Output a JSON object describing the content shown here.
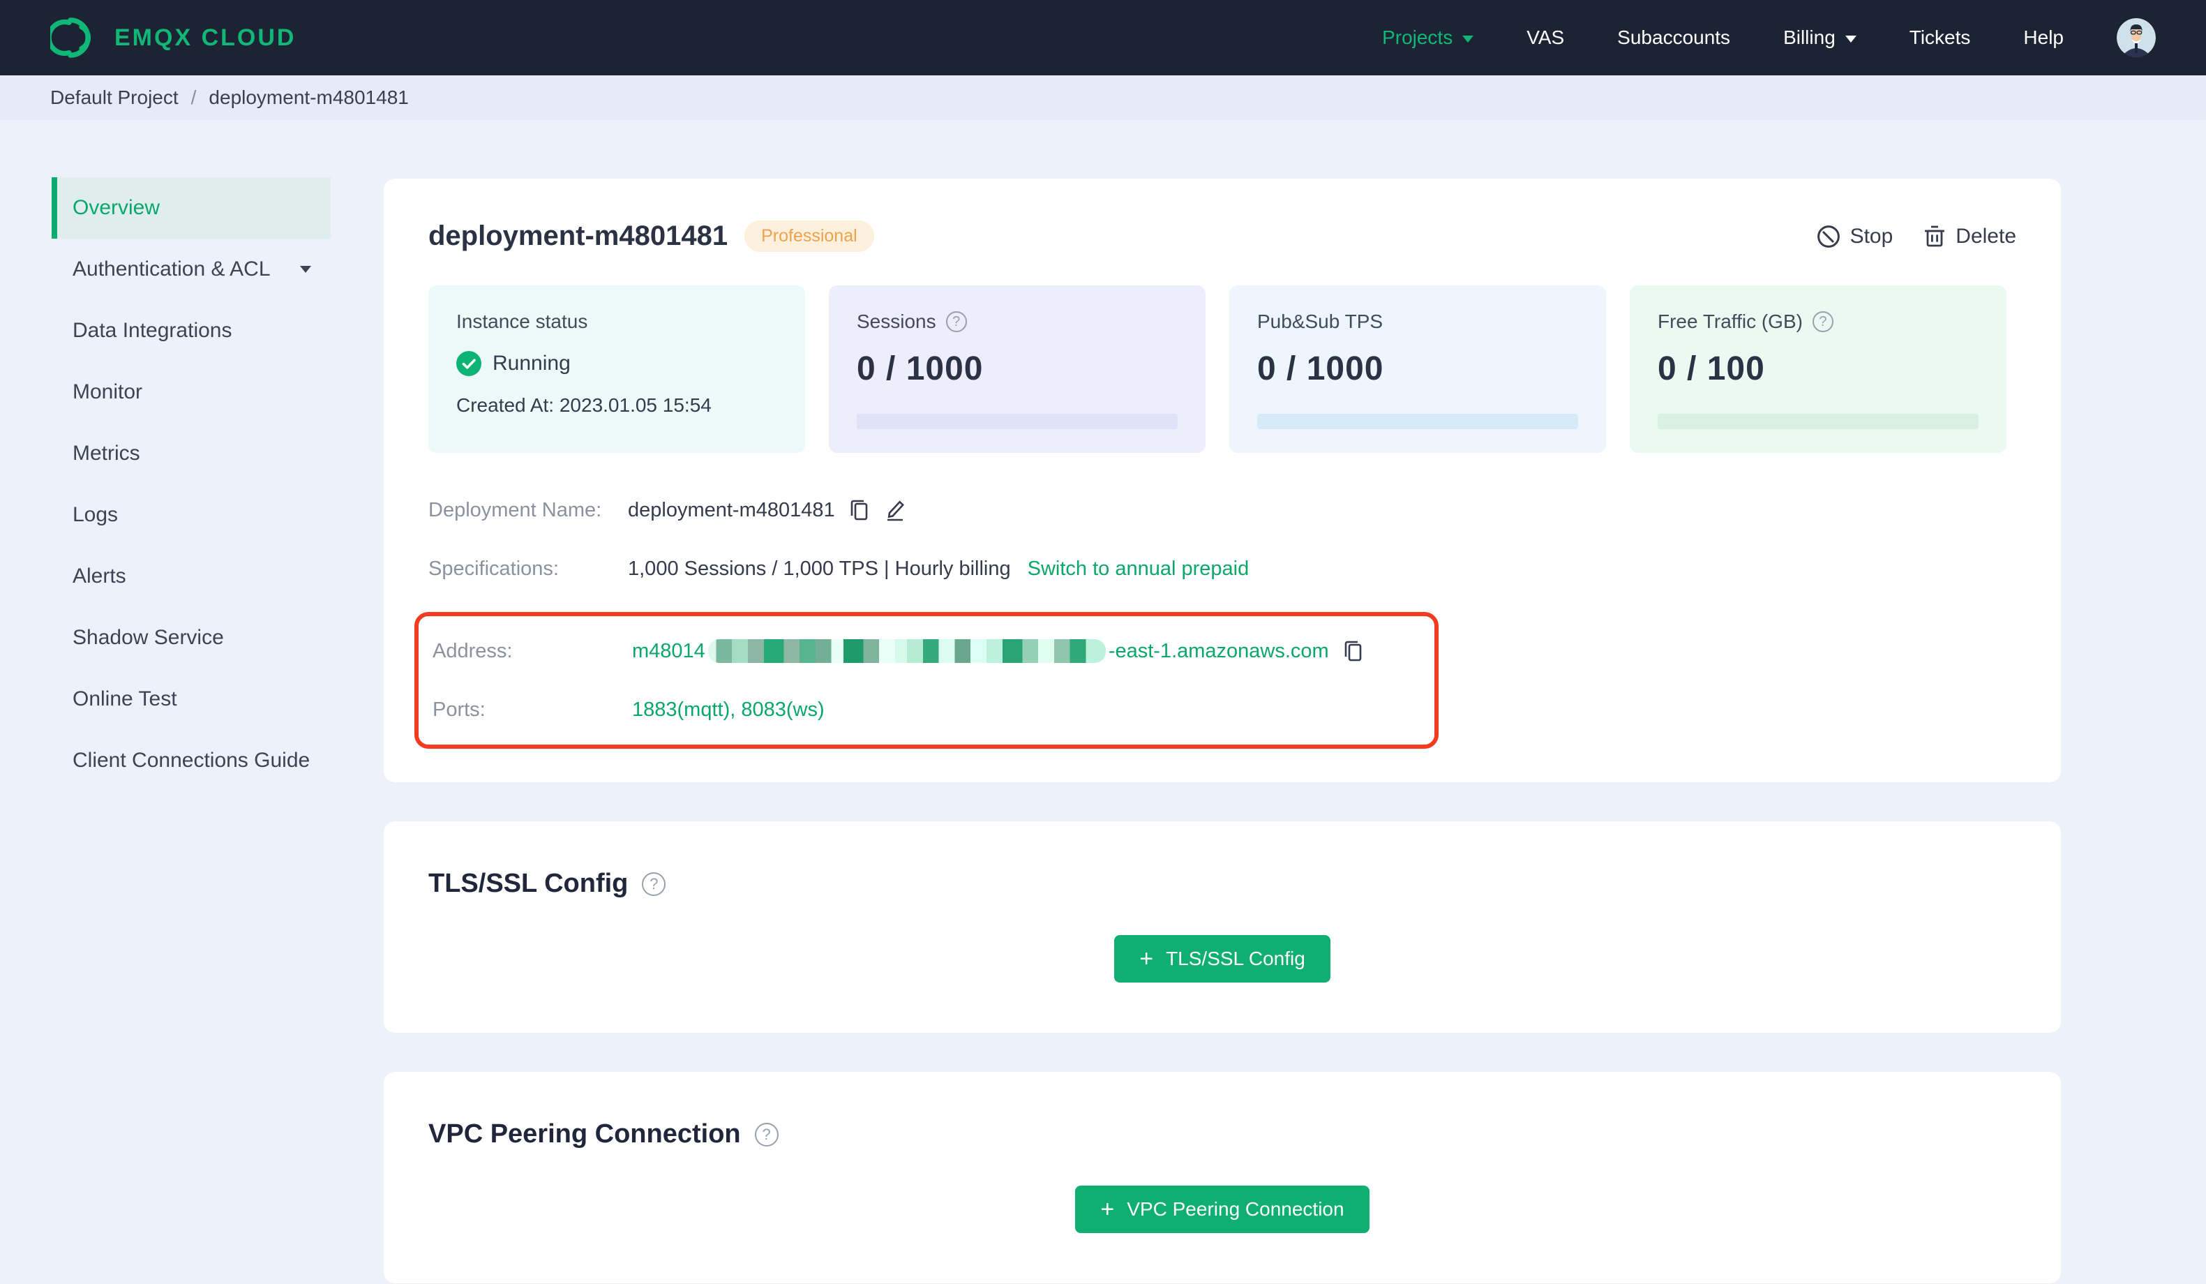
{
  "topbar": {
    "brand": "EMQX CLOUD",
    "nav": [
      {
        "label": "Projects"
      },
      {
        "label": "VAS"
      },
      {
        "label": "Subaccounts"
      },
      {
        "label": "Billing"
      },
      {
        "label": "Tickets"
      },
      {
        "label": "Help"
      }
    ]
  },
  "breadcrumb": {
    "project": "Default Project",
    "separator": "/",
    "current": "deployment-m4801481"
  },
  "sidebar": {
    "items": [
      {
        "label": "Overview"
      },
      {
        "label": "Authentication & ACL"
      },
      {
        "label": "Data Integrations"
      },
      {
        "label": "Monitor"
      },
      {
        "label": "Metrics"
      },
      {
        "label": "Logs"
      },
      {
        "label": "Alerts"
      },
      {
        "label": "Shadow Service"
      },
      {
        "label": "Online Test"
      },
      {
        "label": "Client Connections Guide"
      }
    ]
  },
  "overview": {
    "title": "deployment-m4801481",
    "badge": "Professional",
    "stop_label": "Stop",
    "delete_label": "Delete",
    "stats": [
      {
        "label": "Instance status",
        "status": "Running",
        "created": "Created At: 2023.01.05 15:54"
      },
      {
        "label": "Sessions",
        "value": "0 / 1000"
      },
      {
        "label": "Pub&Sub TPS",
        "value": "0 / 1000"
      },
      {
        "label": "Free Traffic (GB)",
        "value": "0 / 100"
      }
    ],
    "info": {
      "deployment_name_label": "Deployment Name:",
      "deployment_name": "deployment-m4801481",
      "specifications_label": "Specifications:",
      "specifications": "1,000 Sessions / 1,000 TPS | Hourly billing",
      "switch_link": "Switch to annual prepaid",
      "address_label": "Address:",
      "address_prefix": "m48014",
      "address_suffix": "-east-1.amazonaws.com",
      "ports_label": "Ports:",
      "ports": "1883(mqtt), 8083(ws)"
    }
  },
  "tls": {
    "heading": "TLS/SSL Config",
    "button_label": "TLS/SSL Config",
    "plus": "+"
  },
  "vpc": {
    "heading": "VPC Peering Connection",
    "button_label": "VPC Peering Connection",
    "plus": "+"
  },
  "colors": {
    "accent_green": "#0fae71",
    "topbar_navy": "#1c2433",
    "annotation_red": "#f23b1f",
    "badge_orange_text": "#f0a14c",
    "badge_orange_bg": "#fdf0dd"
  }
}
